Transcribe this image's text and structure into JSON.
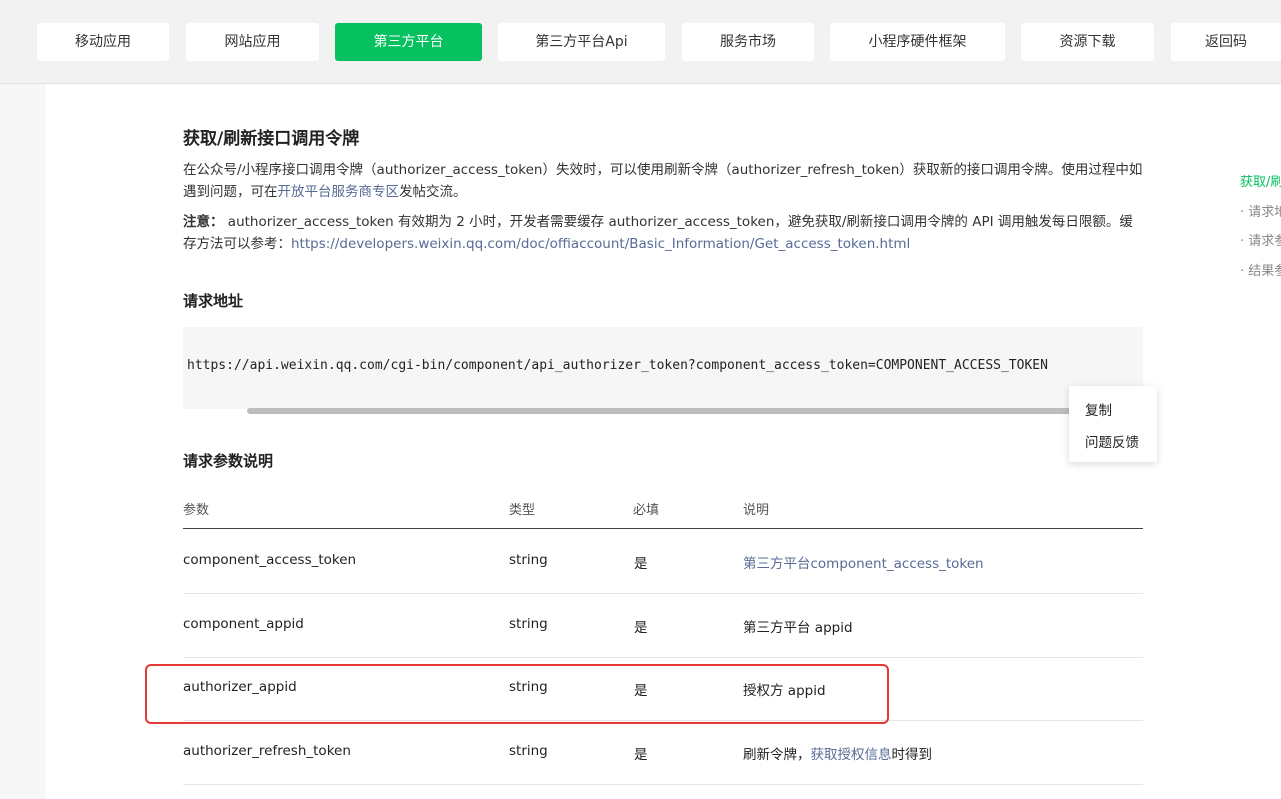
{
  "nav": {
    "tabs": [
      {
        "label": "移动应用"
      },
      {
        "label": "网站应用"
      },
      {
        "label": "第三方平台"
      },
      {
        "label": "第三方平台Api"
      },
      {
        "label": "服务市场"
      },
      {
        "label": "小程序硬件框架"
      },
      {
        "label": "资源下载"
      },
      {
        "label": "返回码"
      }
    ],
    "active_tab": "第三方平台"
  },
  "doc": {
    "title": "获取/刷新接口调用令牌",
    "intro_before_link": "在公众号/小程序接口调用令牌（authorizer_access_token）失效时，可以使用刷新令牌（authorizer_refresh_token）获取新的接口调用令牌。使用过程中如遇到问题，可在",
    "intro_link": "开放平台服务商专区",
    "intro_after_link": "发帖交流。",
    "note_label": "注意：",
    "note_text": " authorizer_access_token 有效期为 2 小时，开发者需要缓存 authorizer_access_token，避免获取/刷新接口调用令牌的 API 调用触发每日限额。缓存方法可以参考：",
    "note_link": "https://developers.weixin.qq.com/doc/offiaccount/Basic_Information/Get_access_token.html",
    "request_url_heading": "请求地址",
    "request_url": "https://api.weixin.qq.com/cgi-bin/component/api_authorizer_token?component_access_token=COMPONENT_ACCESS_TOKEN",
    "params_heading": "请求参数说明"
  },
  "context_menu": {
    "copy": "复制",
    "feedback": "问题反馈"
  },
  "table": {
    "headers": [
      "参数",
      "类型",
      "必填",
      "说明"
    ],
    "rows": [
      {
        "param": "component_access_token",
        "type": "string",
        "required": "是",
        "desc_before": "",
        "desc_link": "第三方平台component_access_token",
        "desc_after": ""
      },
      {
        "param": "component_appid",
        "type": "string",
        "required": "是",
        "desc_before": "第三方平台 appid",
        "desc_link": "",
        "desc_after": ""
      },
      {
        "param": "authorizer_appid",
        "type": "string",
        "required": "是",
        "desc_before": "授权方 appid",
        "desc_link": "",
        "desc_after": ""
      },
      {
        "param": "authorizer_refresh_token",
        "type": "string",
        "required": "是",
        "desc_before": "刷新令牌，",
        "desc_link": "获取授权信息",
        "desc_after": "时得到"
      }
    ]
  },
  "toc": {
    "items": [
      "获取/刷",
      "· 请求地",
      "· 请求参",
      "· 结果参"
    ]
  },
  "colors": {
    "accent": "#07c160",
    "link": "#576b95",
    "highlight_border": "#e53935"
  }
}
